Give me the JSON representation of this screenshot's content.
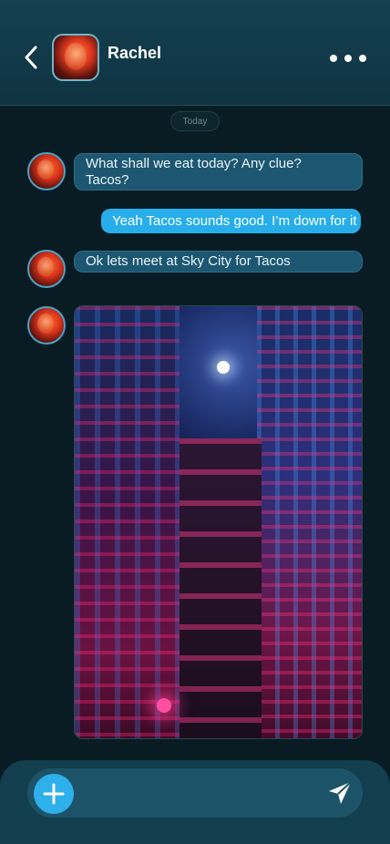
{
  "header": {
    "contact_name": "Rachel",
    "back_icon": "chevron-left-icon",
    "more_icon": "more-horizontal-icon"
  },
  "date_separator": "Today",
  "messages": [
    {
      "from": "contact",
      "text_line1": "What shall we eat today? Any clue?",
      "text_line2": "Tacos?"
    },
    {
      "from": "me",
      "text": "Yeah Tacos sounds good. I’m down for it"
    },
    {
      "from": "contact",
      "text": "Ok lets meet at Sky City for Tacos"
    },
    {
      "from": "contact",
      "type": "image",
      "image_subject": "neon-city-alley-at-night"
    }
  ],
  "composer": {
    "add_icon": "plus-icon",
    "send_icon": "send-icon",
    "input_value": "",
    "input_placeholder": ""
  },
  "colors": {
    "background": "#0a1c23",
    "header": "#14414f",
    "incoming_bubble": "#1d5670",
    "outgoing_bubble": "#27aeea",
    "accent": "#2eb0ec"
  }
}
